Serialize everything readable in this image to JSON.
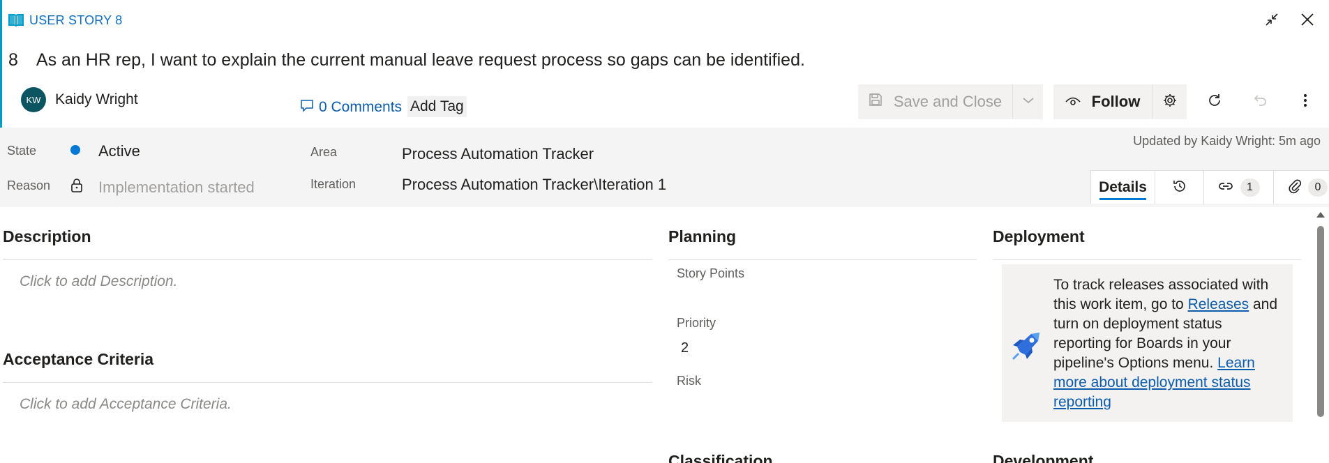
{
  "header": {
    "type_label": "USER STORY 8",
    "id": "8",
    "title": "As an HR rep, I want to explain the current manual leave request process so gaps can be identified.",
    "owner_initials": "KW",
    "owner_name": "Kaidy Wright",
    "comments_label": "0 Comments",
    "add_tag_label": "Add Tag"
  },
  "toolbar": {
    "save_label": "Save and Close",
    "follow_label": "Follow"
  },
  "fields": {
    "state_label": "State",
    "state_value": "Active",
    "reason_label": "Reason",
    "reason_value": "Implementation started",
    "area_label": "Area",
    "area_value": "Process Automation Tracker",
    "iteration_label": "Iteration",
    "iteration_value": "Process Automation Tracker\\Iteration 1",
    "updated_text": "Updated by Kaidy Wright: 5m ago"
  },
  "tabs": {
    "details_label": "Details",
    "links_count": "1",
    "attachments_count": "0"
  },
  "description": {
    "title": "Description",
    "placeholder": "Click to add Description."
  },
  "acceptance": {
    "title": "Acceptance Criteria",
    "placeholder": "Click to add Acceptance Criteria."
  },
  "planning": {
    "title": "Planning",
    "story_points_label": "Story Points",
    "story_points_value": "",
    "priority_label": "Priority",
    "priority_value": "2",
    "risk_label": "Risk",
    "risk_value": ""
  },
  "deployment": {
    "title": "Deployment",
    "text_1": "To track releases associated with this work item, go to ",
    "releases_link": "Releases",
    "text_2": " and turn on deployment status reporting for Boards in your pipeline's Options menu. ",
    "learn_more_link": "Learn more about deployment status reporting"
  },
  "lower_sections": {
    "classification_title": "Classification",
    "development_title": "Development"
  },
  "colors": {
    "accent": "#0078d4",
    "type_accent": "#009ccc",
    "avatar_bg": "#0b5563",
    "link": "#0b5cad"
  }
}
